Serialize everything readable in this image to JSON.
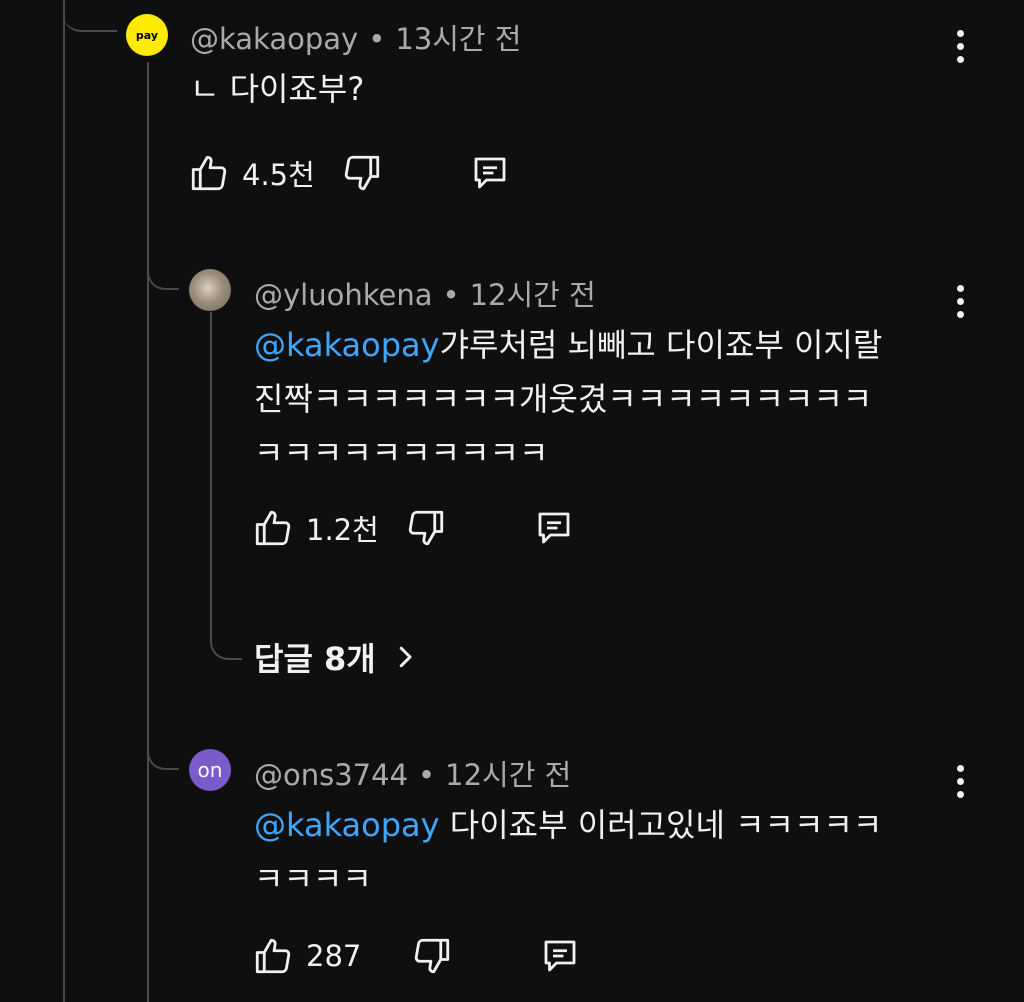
{
  "comments": [
    {
      "author": "@kakaopay",
      "time": "13시간 전",
      "avatar_text": "pay",
      "avatar_color": "#ffeb00",
      "text": "ㄴ 다이죠부?",
      "likes": "4.5천"
    },
    {
      "author": "@yluohkena",
      "time": "12시간 전",
      "mention": "@kakaopay",
      "text": "갸루처럼 뇌빼고 다이죠부 이지랄 진짝ㅋㅋㅋㅋㅋㅋㅋ개웃겼ㅋㅋㅋㅋㅋㅋㅋㅋㅋㅋㅋㅋㅋㅋㅋㅋㅋㅋㅋㅋ",
      "line1": "갸루처럼 뇌빼고 다이죠부 이지랄",
      "line2": "진짝ㅋㅋㅋㅋㅋㅋㅋ개웃겼ㅋㅋㅋㅋㅋㅋㅋㅋㅋ",
      "line3": "ㅋㅋㅋㅋㅋㅋㅋㅋㅋㅋ",
      "likes": "1.2천",
      "replies_label": "답글 8개"
    },
    {
      "author": "@ons3744",
      "time": "12시간 전",
      "avatar_text": "on",
      "avatar_color": "#7b5acb",
      "mention": "@kakaopay",
      "line1": " 다이죠부 이러고있네 ㅋㅋㅋㅋㅋ",
      "line2": "ㅋㅋㅋㅋ",
      "likes": "287"
    }
  ],
  "icons": {
    "like": "thumbs-up-icon",
    "dislike": "thumbs-down-icon",
    "reply": "comment-icon",
    "more": "more-vert-icon",
    "chevron": "chevron-right-icon"
  },
  "colors": {
    "background": "#0f0f0f",
    "mention": "#3ea6ff",
    "meta": "#aaaaaa"
  }
}
